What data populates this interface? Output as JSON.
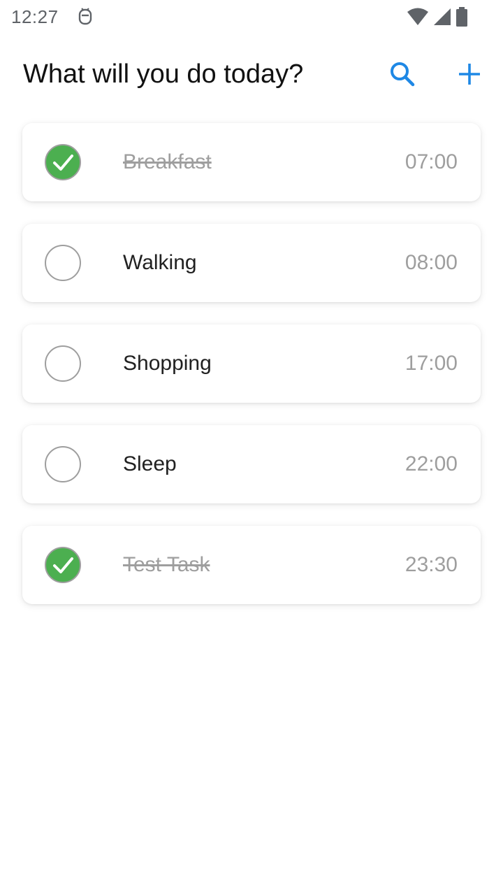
{
  "status_bar": {
    "time": "12:27",
    "notification_icon": "notification-app-icon",
    "icons": [
      "wifi-icon",
      "cellular-signal-icon",
      "battery-icon"
    ]
  },
  "header": {
    "title": "What will you do today?",
    "search_icon": "search-icon",
    "add_icon": "plus-icon"
  },
  "colors": {
    "accent": "#1e88e5",
    "done_green": "#4caf50",
    "muted_text": "#9e9e9e",
    "primary_text": "#212121"
  },
  "tasks": [
    {
      "label": "Breakfast",
      "time": "07:00",
      "done": true
    },
    {
      "label": "Walking",
      "time": "08:00",
      "done": false
    },
    {
      "label": "Shopping",
      "time": "17:00",
      "done": false
    },
    {
      "label": "Sleep",
      "time": "22:00",
      "done": false
    },
    {
      "label": "Test Task",
      "time": "23:30",
      "done": true
    }
  ]
}
